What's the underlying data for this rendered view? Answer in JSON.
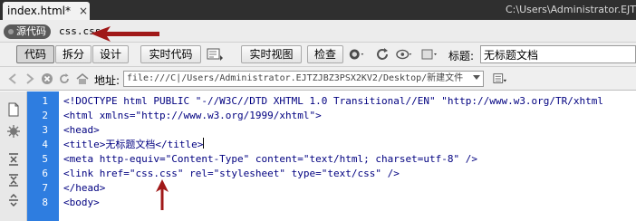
{
  "tab": {
    "name": "index.html*",
    "close": "×"
  },
  "path": "C:\\Users\\Administrator.EJTZ",
  "related": {
    "source": "源代码",
    "file": "css.css"
  },
  "toolbar": {
    "code": "代码",
    "split": "拆分",
    "design": "设计",
    "live_code": "实时代码",
    "live_view": "实时视图",
    "inspect": "检查",
    "title_label": "标题:",
    "title_value": "无标题文档"
  },
  "address": {
    "label": "地址:",
    "value": "file:///C|/Users/Administrator.EJTZJBZ3PSX2KV2/Desktop/新建文件"
  },
  "code_lines": [
    {
      "num": "1",
      "text": "<!DOCTYPE html PUBLIC \"-//W3C//DTD XHTML 1.0 Transitional//EN\" \"http://www.w3.org/TR/xhtml"
    },
    {
      "num": "2",
      "text": "<html xmlns=\"http://www.w3.org/1999/xhtml\">"
    },
    {
      "num": "3",
      "text": "<head>"
    },
    {
      "num": "4",
      "text": "<title>无标题文档</title>"
    },
    {
      "num": "5",
      "text": "<meta http-equiv=\"Content-Type\" content=\"text/html; charset=utf-8\" />"
    },
    {
      "num": "6",
      "text": "<link href=\"css.css\" rel=\"stylesheet\" type=\"text/css\" />"
    },
    {
      "num": "7",
      "text": "</head>"
    },
    {
      "num": "8",
      "text": "<body>"
    }
  ],
  "colors": {
    "gutter": "#2e7de0",
    "code_text": "#000080",
    "annotation_arrow": "#a01818"
  }
}
